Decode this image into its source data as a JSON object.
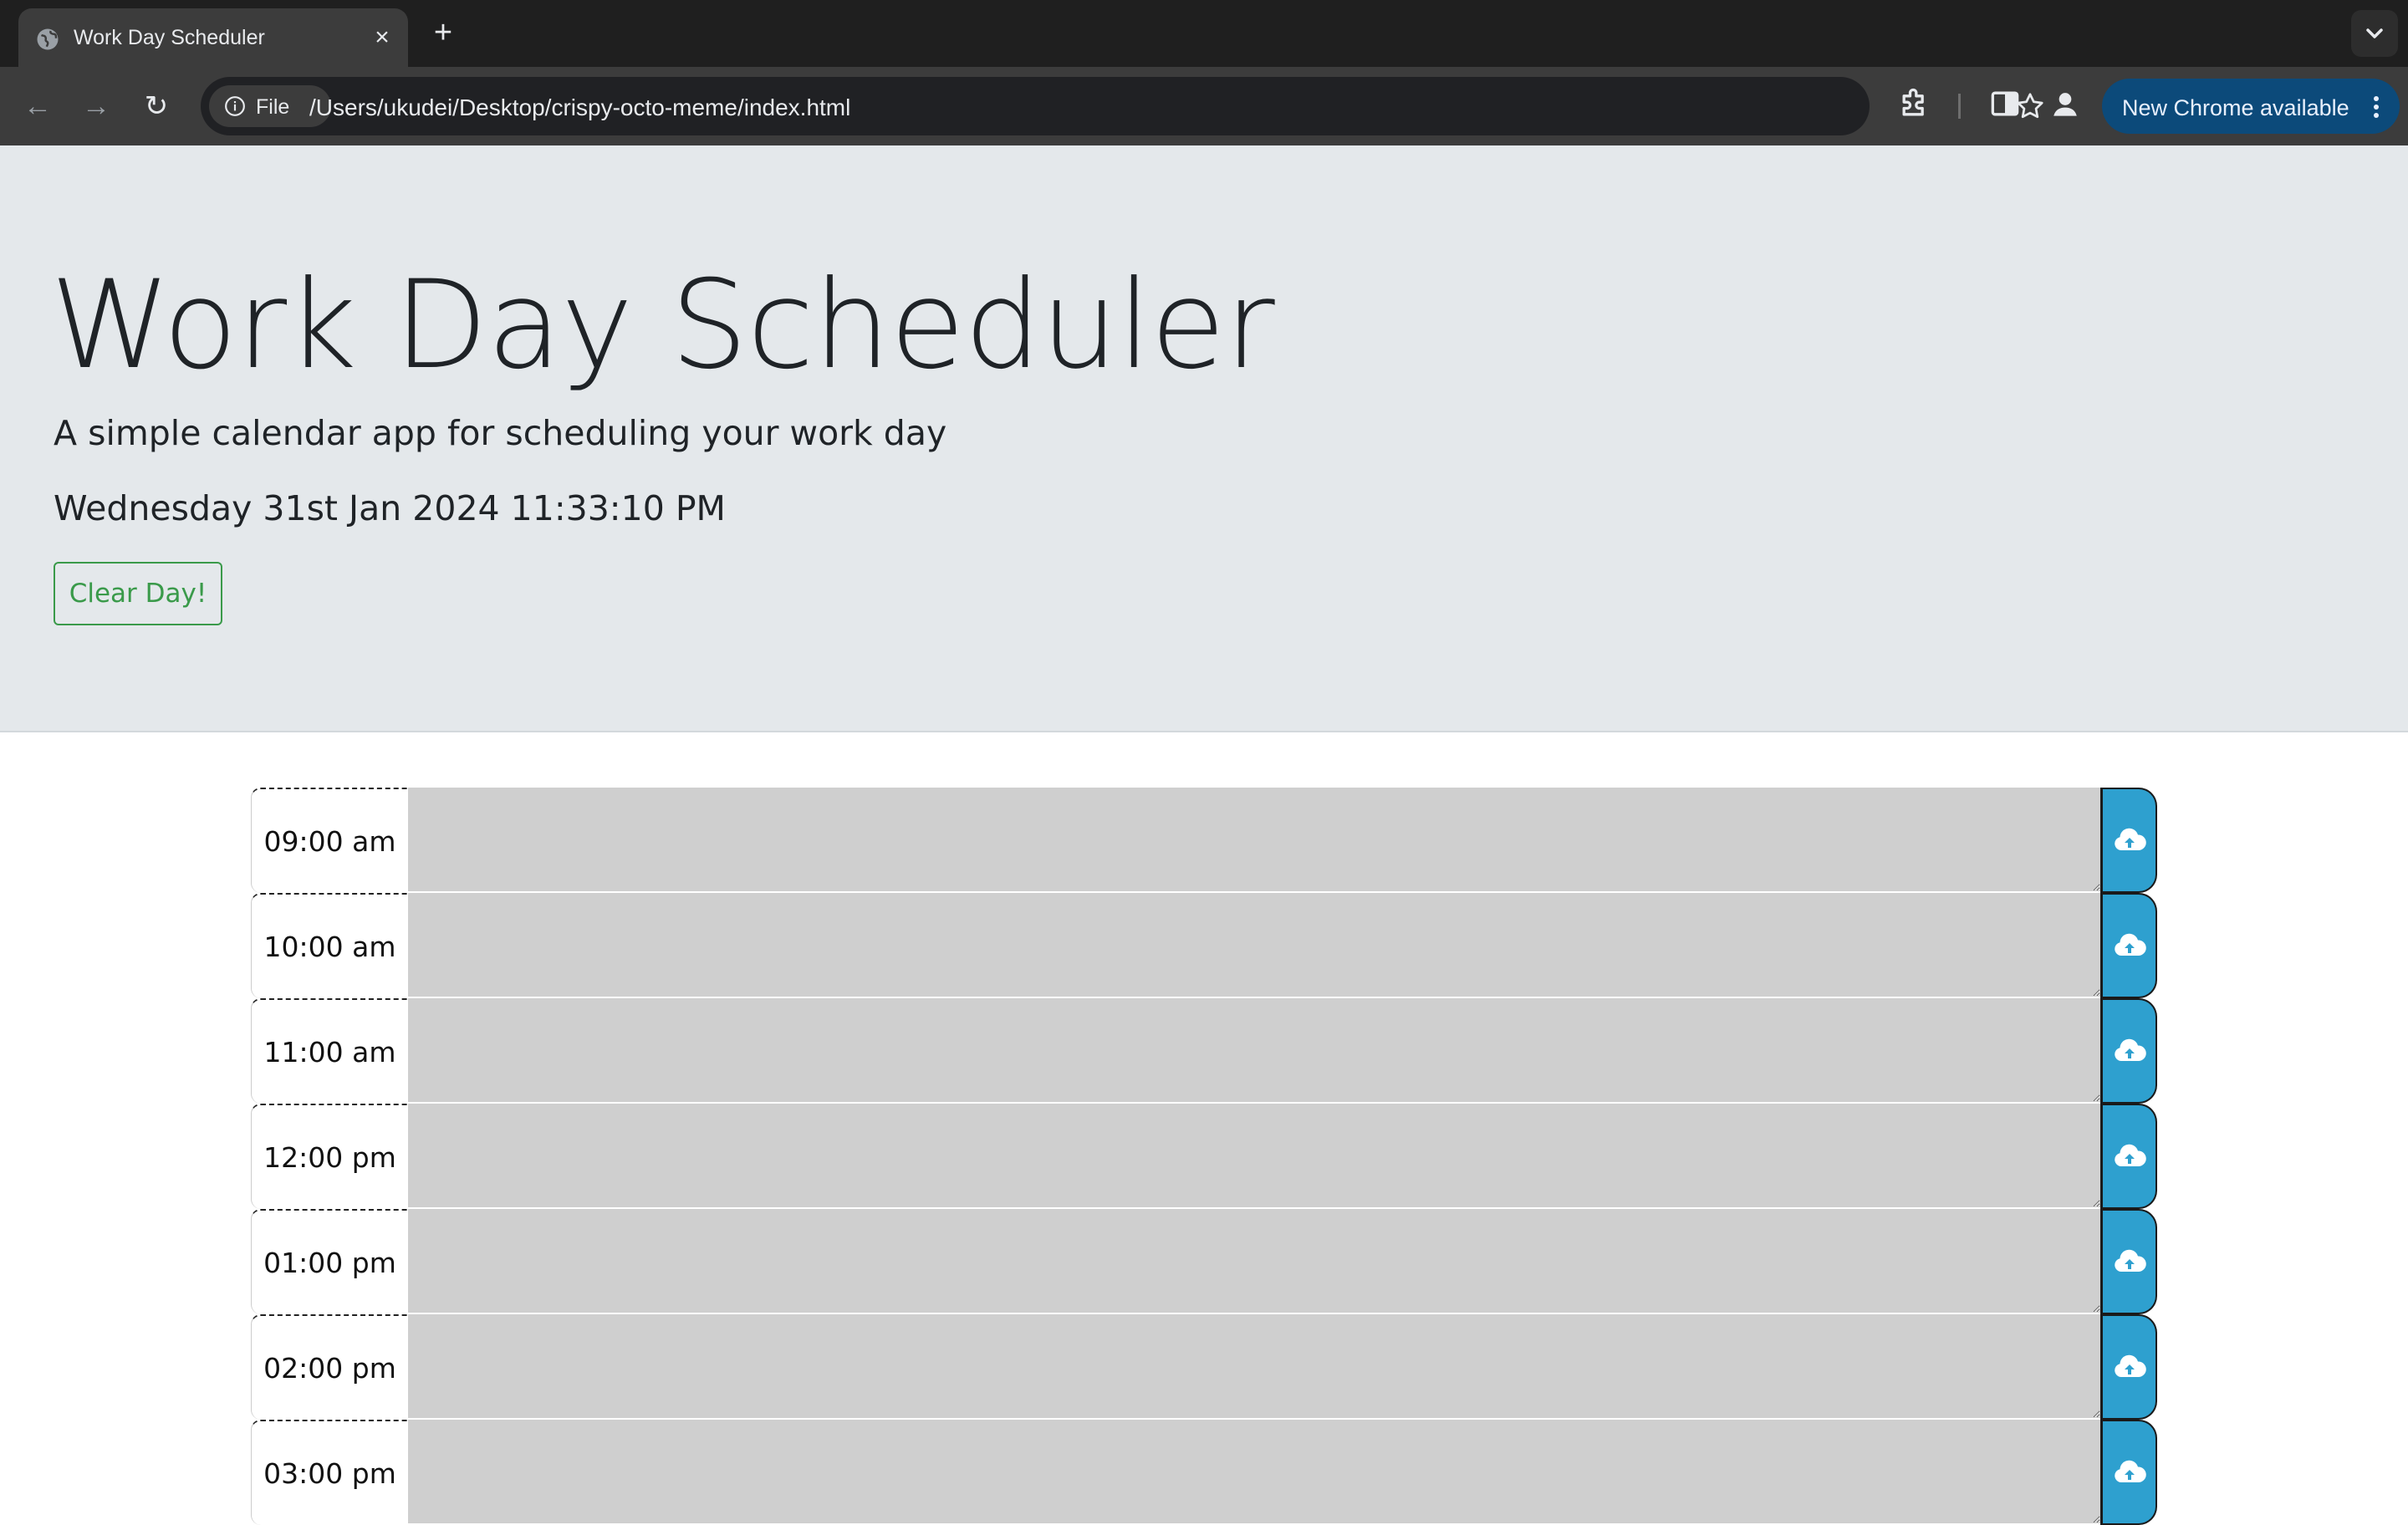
{
  "browser": {
    "tab_title": "Work Day Scheduler",
    "tab_close": "×",
    "new_tab": "+",
    "site_chip": "File",
    "url": "/Users/ukudei/Desktop/crispy-octo-meme/index.html",
    "update_label": "New Chrome available",
    "back": "←",
    "forward": "→",
    "reload": "↻"
  },
  "header": {
    "title": "Work Day Scheduler",
    "lead": "A simple calendar app for scheduling your work day",
    "current_datetime": "Wednesday 31st Jan 2024 11:33:10 PM",
    "clear_button": "Clear Day!"
  },
  "schedule": {
    "hours": [
      {
        "label": "09:00 am",
        "text": ""
      },
      {
        "label": "10:00 am",
        "text": ""
      },
      {
        "label": "11:00 am",
        "text": ""
      },
      {
        "label": "12:00 pm",
        "text": ""
      },
      {
        "label": "01:00 pm",
        "text": ""
      },
      {
        "label": "02:00 pm",
        "text": ""
      },
      {
        "label": "03:00 pm",
        "text": ""
      }
    ]
  },
  "colors": {
    "past_block": "#cfcfcf",
    "save_button": "#2ea0cf",
    "clear_button": "#3a9a4a",
    "jumbotron": "#e4e8eb",
    "update_pill": "#0c4a7a"
  },
  "icons": {
    "save": "cloud-upload-icon",
    "tab_favicon": "globe-icon",
    "site_chip": "info-icon"
  }
}
